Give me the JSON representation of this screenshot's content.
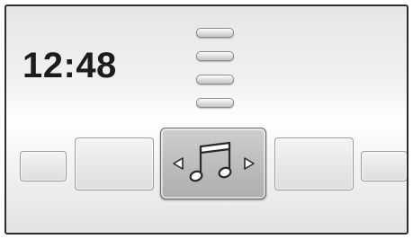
{
  "clock": {
    "time": "12:48"
  },
  "menu": {
    "icon": "menu-lines-icon",
    "line_count": 4
  },
  "carousel": {
    "selected_icon": "music-note-icon",
    "left_arrow_icon": "triangle-left-icon",
    "right_arrow_icon": "triangle-right-icon"
  },
  "colors": {
    "background_light": "#ffffff",
    "background_dark": "#e3e3e3",
    "border": "#2e2e2e",
    "text": "#1c1c1c",
    "selected_tile": "#bdbdbd"
  }
}
